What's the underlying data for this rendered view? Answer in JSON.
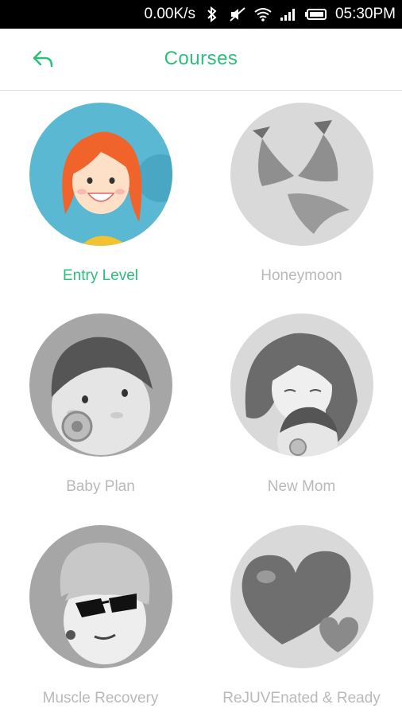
{
  "status_bar": {
    "network_speed": "0.00K/s",
    "time": "05:30PM",
    "icons": [
      "bluetooth-icon",
      "mute-icon",
      "wifi-icon",
      "signal-icon",
      "battery-icon"
    ]
  },
  "app_bar": {
    "back_icon": "back-arrow-icon",
    "title": "Courses"
  },
  "colors": {
    "accent": "#2bbf7b",
    "inactive_label": "#b9b9b9",
    "inactive_circle": "#d9d9d9"
  },
  "courses": [
    {
      "label": "Entry Level",
      "active": true
    },
    {
      "label": "Honeymoon",
      "active": false
    },
    {
      "label": "Baby Plan",
      "active": false
    },
    {
      "label": "New Mom",
      "active": false
    },
    {
      "label": "Muscle Recovery",
      "active": false
    },
    {
      "label": "ReJUVEnated & Ready",
      "active": false
    }
  ]
}
